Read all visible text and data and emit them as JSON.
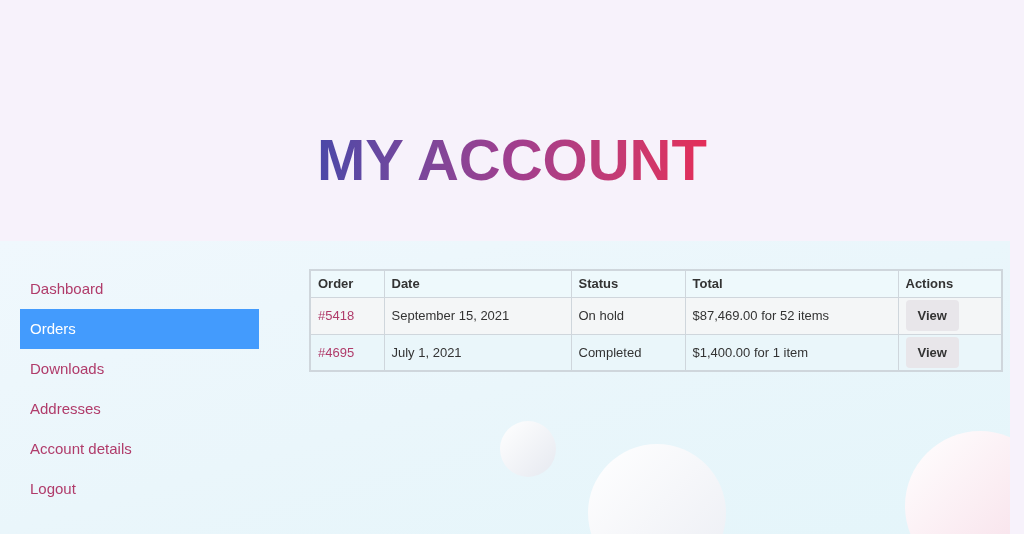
{
  "page_title": "MY ACCOUNT",
  "nav": [
    {
      "label": "Dashboard",
      "selected": false
    },
    {
      "label": "Orders",
      "selected": true
    },
    {
      "label": "Downloads",
      "selected": false
    },
    {
      "label": "Addresses",
      "selected": false
    },
    {
      "label": "Account details",
      "selected": false
    },
    {
      "label": "Logout",
      "selected": false
    }
  ],
  "orders_table": {
    "columns": [
      "Order",
      "Date",
      "Status",
      "Total",
      "Actions"
    ],
    "rows": [
      {
        "order": "#5418",
        "date": "September 15, 2021",
        "status": "On hold",
        "total": "$87,469.00 for 52 items",
        "action": "View"
      },
      {
        "order": "#4695",
        "date": "July 1, 2021",
        "status": "Completed",
        "total": "$1,400.00 for 1 item",
        "action": "View"
      }
    ]
  }
}
